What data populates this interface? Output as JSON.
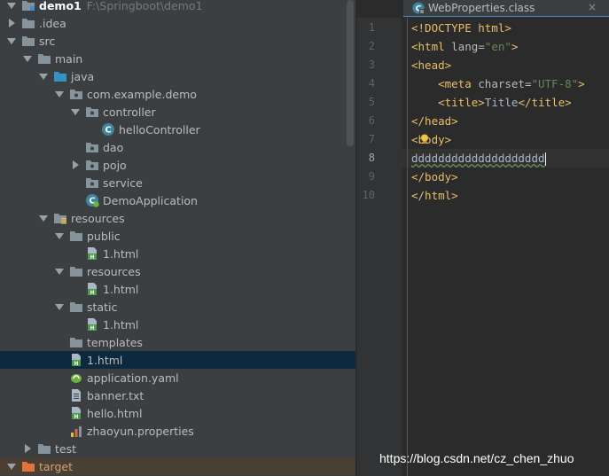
{
  "project": {
    "root_name": "demo1",
    "root_path": "F:\\Springboot\\demo1",
    "items": [
      {
        "label": "demo1",
        "depth": 0,
        "arrow": "down",
        "icon": "module-folder-icon",
        "name": "tree-item-demo1"
      },
      {
        "label": ".idea",
        "depth": 0,
        "arrow": "right",
        "icon": "folder-icon",
        "name": "tree-item-idea"
      },
      {
        "label": "src",
        "depth": 0,
        "arrow": "down",
        "icon": "folder-icon",
        "name": "tree-item-src"
      },
      {
        "label": "main",
        "depth": 1,
        "arrow": "down",
        "icon": "folder-icon",
        "name": "tree-item-main"
      },
      {
        "label": "java",
        "depth": 2,
        "arrow": "down",
        "icon": "source-folder-icon",
        "name": "tree-item-java"
      },
      {
        "label": "com.example.demo",
        "depth": 3,
        "arrow": "down",
        "icon": "package-icon",
        "name": "tree-item-com-example-demo"
      },
      {
        "label": "controller",
        "depth": 4,
        "arrow": "down",
        "icon": "package-icon",
        "name": "tree-item-controller"
      },
      {
        "label": "helloController",
        "depth": 5,
        "arrow": "none",
        "icon": "java-class-icon",
        "name": "tree-item-hellocontroller"
      },
      {
        "label": "dao",
        "depth": 4,
        "arrow": "none",
        "icon": "package-icon",
        "name": "tree-item-dao"
      },
      {
        "label": "pojo",
        "depth": 4,
        "arrow": "right",
        "icon": "package-icon",
        "name": "tree-item-pojo"
      },
      {
        "label": "service",
        "depth": 4,
        "arrow": "none",
        "icon": "package-icon",
        "name": "tree-item-service"
      },
      {
        "label": "DemoApplication",
        "depth": 4,
        "arrow": "none",
        "icon": "spring-boot-class-icon",
        "name": "tree-item-demoapplication"
      },
      {
        "label": "resources",
        "depth": 2,
        "arrow": "down",
        "icon": "resources-folder-icon",
        "name": "tree-item-resources"
      },
      {
        "label": "public",
        "depth": 3,
        "arrow": "down",
        "icon": "folder-icon",
        "name": "tree-item-public"
      },
      {
        "label": "1.html",
        "depth": 4,
        "arrow": "none",
        "icon": "html-file-icon",
        "name": "tree-item-public-1-html"
      },
      {
        "label": "resources",
        "depth": 3,
        "arrow": "down",
        "icon": "folder-icon",
        "name": "tree-item-resources-sub"
      },
      {
        "label": "1.html",
        "depth": 4,
        "arrow": "none",
        "icon": "html-file-icon",
        "name": "tree-item-resources-1-html"
      },
      {
        "label": "static",
        "depth": 3,
        "arrow": "down",
        "icon": "folder-icon",
        "name": "tree-item-static"
      },
      {
        "label": "1.html",
        "depth": 4,
        "arrow": "none",
        "icon": "html-file-icon",
        "name": "tree-item-static-1-html"
      },
      {
        "label": "templates",
        "depth": 3,
        "arrow": "none",
        "icon": "folder-icon",
        "name": "tree-item-templates"
      },
      {
        "label": "1.html",
        "depth": 3,
        "arrow": "none",
        "icon": "html-file-icon",
        "name": "tree-item-1-html",
        "selected": true
      },
      {
        "label": "application.yaml",
        "depth": 3,
        "arrow": "none",
        "icon": "yaml-file-icon",
        "name": "tree-item-application-yaml"
      },
      {
        "label": "banner.txt",
        "depth": 3,
        "arrow": "none",
        "icon": "text-file-icon",
        "name": "tree-item-banner-txt"
      },
      {
        "label": "hello.html",
        "depth": 3,
        "arrow": "none",
        "icon": "html-file-icon",
        "name": "tree-item-hello-html"
      },
      {
        "label": "zhaoyun.properties",
        "depth": 3,
        "arrow": "none",
        "icon": "properties-file-icon",
        "name": "tree-item-zhaoyun-properties"
      },
      {
        "label": "test",
        "depth": 1,
        "arrow": "right",
        "icon": "folder-icon",
        "name": "tree-item-test"
      },
      {
        "label": "target",
        "depth": 0,
        "arrow": "down",
        "icon": "excluded-folder-icon",
        "name": "tree-item-target",
        "excluded": true
      }
    ]
  },
  "editor": {
    "tab_label": "WebProperties.class",
    "tab_close": "×",
    "current_line": 8,
    "lines": [
      {
        "n": "1",
        "tokens": [
          [
            "tag",
            "<!DOCTYPE html>"
          ]
        ]
      },
      {
        "n": "2",
        "tokens": [
          [
            "tag",
            "<html "
          ],
          [
            "attr",
            "lang="
          ],
          [
            "str",
            "\"en\""
          ],
          [
            "tag",
            ">"
          ]
        ]
      },
      {
        "n": "3",
        "tokens": [
          [
            "tag",
            "<head>"
          ]
        ]
      },
      {
        "n": "4",
        "tokens": [
          [
            "text",
            "    "
          ],
          [
            "tag",
            "<meta "
          ],
          [
            "attr",
            "charset="
          ],
          [
            "str",
            "\"UTF-8\""
          ],
          [
            "tag",
            ">"
          ]
        ]
      },
      {
        "n": "5",
        "tokens": [
          [
            "text",
            "    "
          ],
          [
            "tag",
            "<title>"
          ],
          [
            "text",
            "Title"
          ],
          [
            "tag",
            "</title>"
          ]
        ]
      },
      {
        "n": "6",
        "tokens": [
          [
            "tag",
            "</head>"
          ]
        ]
      },
      {
        "n": "7",
        "tokens": [
          [
            "tag",
            "<body>"
          ]
        ]
      },
      {
        "n": "8",
        "tokens": [
          [
            "typo",
            "dddddddddddddddddddd"
          ]
        ]
      },
      {
        "n": "9",
        "tokens": [
          [
            "tag",
            "</body>"
          ]
        ]
      },
      {
        "n": "10",
        "tokens": [
          [
            "tag",
            "</html>"
          ]
        ]
      }
    ]
  },
  "watermark": "https://blog.csdn.net/cz_chen_zhuo",
  "colors": {
    "panel_bg": "#3c3f41",
    "editor_bg": "#2b2b2b",
    "selection": "#0d293e",
    "tag": "#e8bf6a",
    "string": "#6a8759"
  }
}
